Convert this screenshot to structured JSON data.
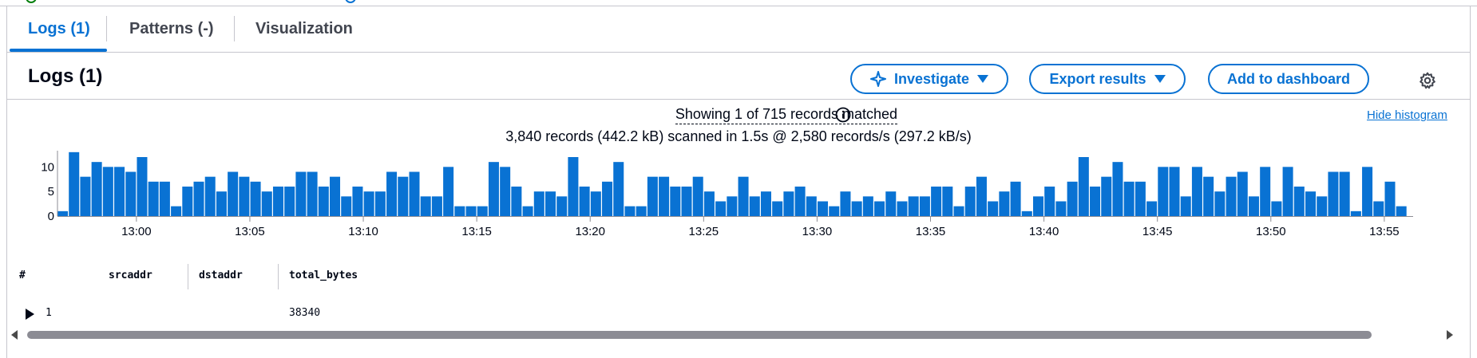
{
  "tabs": [
    {
      "label": "Logs (1)",
      "active": true
    },
    {
      "label": "Patterns (-)",
      "active": false
    },
    {
      "label": "Visualization",
      "active": false
    }
  ],
  "panel": {
    "title": "Logs (1)",
    "investigate_label": "Investigate",
    "export_label": "Export results",
    "add_dashboard_label": "Add to dashboard",
    "settings_icon": "gear-icon"
  },
  "summary": {
    "matched": "Showing 1 of 715 records matched",
    "scanned": "3,840 records (442.2 kB) scanned in 1.5s @ 2,580 records/s (297.2 kB/s)",
    "hide_histogram": "Hide histogram"
  },
  "chart_data": {
    "type": "bar",
    "title": "",
    "xlabel": "",
    "ylabel": "",
    "ylim": [
      0,
      12
    ],
    "yticks": [
      0,
      5,
      10
    ],
    "xticks": [
      "13:00",
      "13:05",
      "13:10",
      "13:15",
      "13:20",
      "13:25",
      "13:30",
      "13:35",
      "13:40",
      "13:45",
      "13:50",
      "13:55"
    ],
    "values": [
      1,
      13,
      8,
      11,
      10,
      10,
      9,
      12,
      7,
      7,
      2,
      6,
      7,
      8,
      5,
      9,
      8,
      7,
      5,
      6,
      6,
      9,
      9,
      6,
      8,
      4,
      6,
      5,
      5,
      9,
      8,
      9,
      4,
      4,
      10,
      2,
      2,
      2,
      11,
      10,
      6,
      2,
      5,
      5,
      4,
      12,
      6,
      5,
      7,
      11,
      2,
      2,
      8,
      8,
      6,
      6,
      8,
      5,
      3,
      4,
      8,
      4,
      5,
      3,
      5,
      6,
      4,
      3,
      2,
      5,
      3,
      4,
      3,
      5,
      3,
      4,
      4,
      6,
      6,
      2,
      6,
      8,
      3,
      5,
      7,
      1,
      4,
      6,
      3,
      7,
      12,
      6,
      8,
      11,
      7,
      7,
      3,
      10,
      10,
      4,
      10,
      8,
      5,
      8,
      9,
      4,
      10,
      3,
      10,
      6,
      5,
      4,
      9,
      9,
      1,
      10,
      3,
      7,
      2
    ],
    "color": "#0972d3"
  },
  "table": {
    "columns": [
      "#",
      "srcaddr",
      "dstaddr",
      "total_bytes"
    ],
    "rows": [
      {
        "index": "1",
        "srcaddr": "",
        "dstaddr": "",
        "total_bytes": "38340"
      }
    ]
  }
}
